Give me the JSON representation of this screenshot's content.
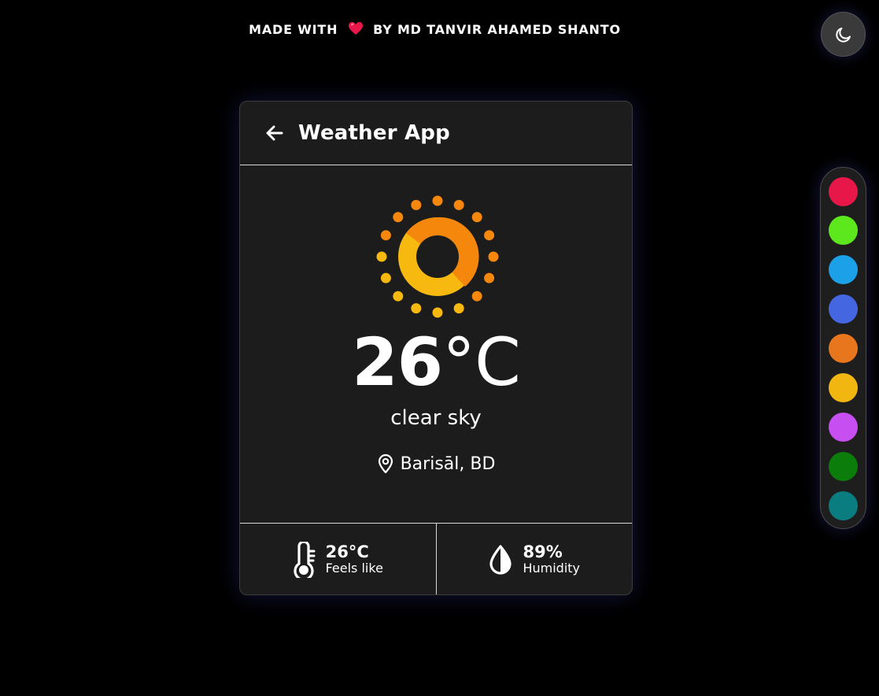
{
  "credit": {
    "prefix": "MADE WITH",
    "suffix": "BY MD TANVIR AHAMED SHANTO"
  },
  "theme_toggle": {
    "icon": "moon-icon"
  },
  "palette": {
    "colors": [
      "#e8174a",
      "#5ce81c",
      "#1ca0e8",
      "#4466e0",
      "#e8761c",
      "#f2b611",
      "#c74ef0",
      "#0a7d0a",
      "#0a7d80"
    ]
  },
  "card": {
    "title": "Weather App",
    "temperature": "26",
    "temperature_unit": "°C",
    "condition": "clear sky",
    "location": "Barisāl, BD",
    "feels_like": {
      "value": "26°C",
      "label": "Feels like"
    },
    "humidity": {
      "value": "89%",
      "label": "Humidity"
    }
  },
  "colors": {
    "sun_primary": "#f7b80f",
    "sun_secondary": "#f5870d",
    "accent": "#e8174a"
  }
}
